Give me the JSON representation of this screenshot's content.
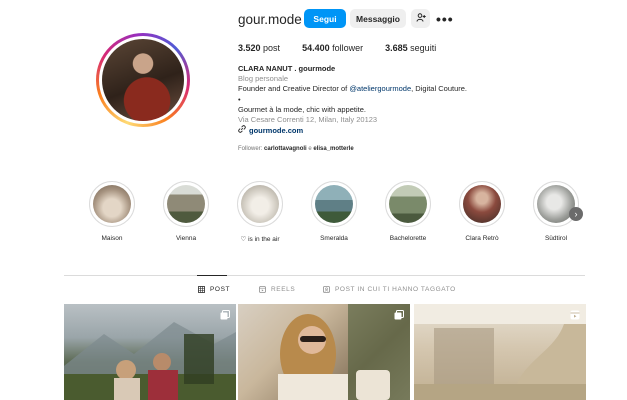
{
  "profile": {
    "username": "gour.mode",
    "follow_label": "Segui",
    "message_label": "Messaggio",
    "stats": {
      "posts": "3.520",
      "posts_label": "post",
      "followers": "54.400",
      "followers_label": "follower",
      "following": "3.685",
      "following_label": "seguiti"
    },
    "bio": {
      "name": "CLARA NANUT . gourmode",
      "category": "Blog personale",
      "line1_pre": "Founder and Creative Director of ",
      "line1_mention": "@ateliergourmode",
      "line1_post": ", Digital Couture.",
      "bullet": "•",
      "line2": "Gourmet à la mode, chic with appetite.",
      "address": "Via Cesare Correnti 12, Milan, Italy 20123",
      "link": "gourmode.com"
    },
    "followers_line": {
      "prefix": "Follower: ",
      "user1": "carlottavagnoli",
      "sep": " e ",
      "user2": "elisa_motterle"
    }
  },
  "highlights": [
    {
      "label": "Maison",
      "color": "#a89582"
    },
    {
      "label": "Vienna",
      "color": "#6f7a5c"
    },
    {
      "label": "♡ is in the air",
      "color": "#cfcac0"
    },
    {
      "label": "Smeralda",
      "color": "#5f7f86"
    },
    {
      "label": "Bachelorette",
      "color": "#7a8a6a"
    },
    {
      "label": "Clara Retrò",
      "color": "#8b4a3e"
    },
    {
      "label": "Südtirol",
      "color": "#9b9d99"
    }
  ],
  "tabs": [
    {
      "label": "POST",
      "icon": "grid-icon",
      "active": true
    },
    {
      "label": "REELS",
      "icon": "reels-icon",
      "active": false
    },
    {
      "label": "POST IN CUI TI HANNO TAGGATO",
      "icon": "tagged-icon",
      "active": false
    }
  ],
  "colors": {
    "accent": "#0095f6",
    "text": "#262626",
    "muted": "#8e8e8e",
    "link": "#00376b"
  }
}
